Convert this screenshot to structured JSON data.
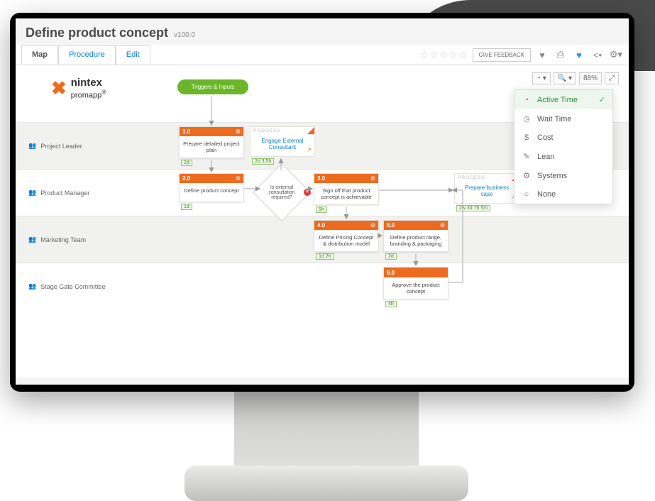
{
  "header": {
    "title": "Define product concept",
    "version": "v100.0"
  },
  "tabs": [
    {
      "id": "map",
      "label": "Map",
      "active": true
    },
    {
      "id": "procedure",
      "label": "Procedure",
      "active": false
    },
    {
      "id": "edit",
      "label": "Edit",
      "active": false
    }
  ],
  "feedback_button": "GIVE FEEDBACK",
  "zoom": {
    "percent": "88%"
  },
  "brand": {
    "line1": "nintex",
    "line2": "promapp"
  },
  "overlay_menu": [
    {
      "icon": "clock-fast",
      "label": "Active Time",
      "selected": true
    },
    {
      "icon": "clock",
      "label": "Wait Time"
    },
    {
      "icon": "dollar",
      "label": "Cost"
    },
    {
      "icon": "leaf",
      "label": "Lean"
    },
    {
      "icon": "gear",
      "label": "Systems"
    },
    {
      "icon": "circle",
      "label": "None"
    }
  ],
  "lanes": [
    {
      "role": "Project Leader"
    },
    {
      "role": "Product Manager"
    },
    {
      "role": "Marketing Team"
    },
    {
      "role": "Stage Gate Committee"
    }
  ],
  "trigger_label": "Triggers & Inputs",
  "process_tag": "PROCESS",
  "steps": {
    "s1": {
      "num": "1.0",
      "title": "Prepare detailed project plan",
      "dur": "2d"
    },
    "p1": {
      "title": "Engage External Consultant",
      "dur": "2d 3.5h"
    },
    "s2": {
      "num": "2.0",
      "title": "Define product concept",
      "dur": "1d"
    },
    "d1": {
      "title": "Is external consultation required?"
    },
    "s3": {
      "num": "3.0",
      "title": "Sign off that product concept is achievable",
      "dur": "5h"
    },
    "s4": {
      "num": "4.0",
      "title": "Define Pricing Concept & distribution model",
      "dur": "1d 2h"
    },
    "s5": {
      "num": "5.0",
      "title": "Define product range, branding & packaging",
      "dur": "2d"
    },
    "s6": {
      "num": "6.0",
      "title": "Approve the product concept",
      "dur": "4h"
    },
    "p2": {
      "title": "Prepare business case",
      "dur": "2w 3d 7h 5m"
    }
  }
}
